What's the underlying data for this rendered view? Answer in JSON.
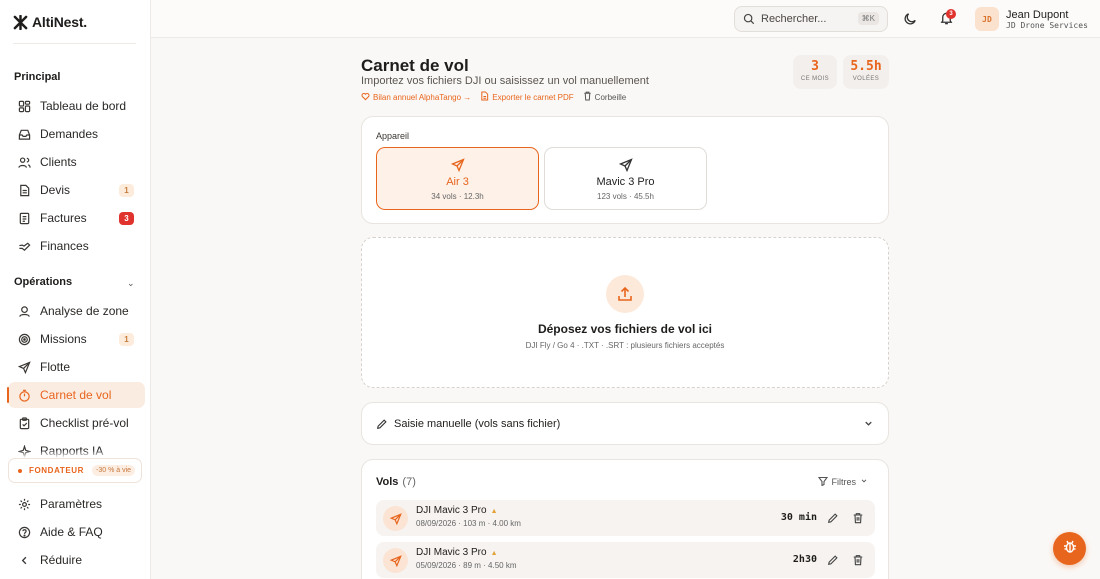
{
  "brand": {
    "name": "AltiNest."
  },
  "sidebar": {
    "section_principal": "Principal",
    "principal_items": [
      {
        "label": "Tableau de bord",
        "icon": "dashboard-icon"
      },
      {
        "label": "Demandes",
        "icon": "inbox-icon"
      },
      {
        "label": "Clients",
        "icon": "users-icon"
      },
      {
        "label": "Devis",
        "icon": "document-icon",
        "badge": "1"
      },
      {
        "label": "Factures",
        "icon": "invoice-icon",
        "badge": "3"
      },
      {
        "label": "Finances",
        "icon": "finance-icon"
      }
    ],
    "section_operations": "Opérations",
    "operation_items": [
      {
        "label": "Analyse de zone",
        "icon": "zone-icon"
      },
      {
        "label": "Missions",
        "icon": "target-icon",
        "badge": "1"
      },
      {
        "label": "Flotte",
        "icon": "plane-icon"
      },
      {
        "label": "Carnet de vol",
        "icon": "timer-icon",
        "active": true
      },
      {
        "label": "Checklist pré-vol",
        "icon": "clipboard-icon"
      },
      {
        "label": "Rapports IA",
        "icon": "sparkle-icon"
      }
    ],
    "founder": {
      "label": "FONDATEUR",
      "promo": "-30 % à vie"
    },
    "bottom_items": [
      {
        "label": "Paramètres",
        "icon": "gear-icon"
      },
      {
        "label": "Aide & FAQ",
        "icon": "help-icon"
      },
      {
        "label": "Réduire",
        "icon": "chevron-left-icon"
      }
    ]
  },
  "header": {
    "search_placeholder": "Rechercher...",
    "search_shortcut": "⌘K",
    "notifications_count": "3",
    "user": {
      "initials": "JD",
      "name": "Jean Dupont",
      "org": "JD Drone Services"
    }
  },
  "page": {
    "title": "Carnet de vol",
    "subtitle": "Importez vos fichiers DJI ou saisissez un vol manuellement",
    "links": {
      "annual": "Bilan annuel AlphaTango →",
      "export": "Exporter le carnet PDF",
      "trash": "Corbeille"
    },
    "stats": [
      {
        "value": "3",
        "label": "CE MOIS"
      },
      {
        "value": "5.5h",
        "label": "VOLÉES"
      }
    ]
  },
  "device_section": {
    "label": "Appareil",
    "devices": [
      {
        "name": "Air 3",
        "meta": "34 vols · 12.3h",
        "selected": true
      },
      {
        "name": "Mavic 3 Pro",
        "meta": "123 vols · 45.5h",
        "selected": false
      }
    ]
  },
  "dropzone": {
    "title": "Déposez vos fichiers de vol ici",
    "subtitle": "DJI Fly / Go 4 · .TXT · .SRT : plusieurs fichiers acceptés"
  },
  "manual_entry": {
    "label": "Saisie manuelle (vols sans fichier)"
  },
  "flights": {
    "title": "Vols",
    "count": "(7)",
    "filters_label": "Filtres",
    "rows": [
      {
        "drone": "DJI Mavic 3 Pro",
        "meta": "08/09/2026 · 103 m · 4.00 km",
        "duration": "30 min"
      },
      {
        "drone": "DJI Mavic 3 Pro",
        "meta": "05/09/2026 · 89 m · 4.50 km",
        "duration": "2h30"
      }
    ]
  },
  "colors": {
    "accent": "#e8651d",
    "danger": "#e0332d"
  }
}
